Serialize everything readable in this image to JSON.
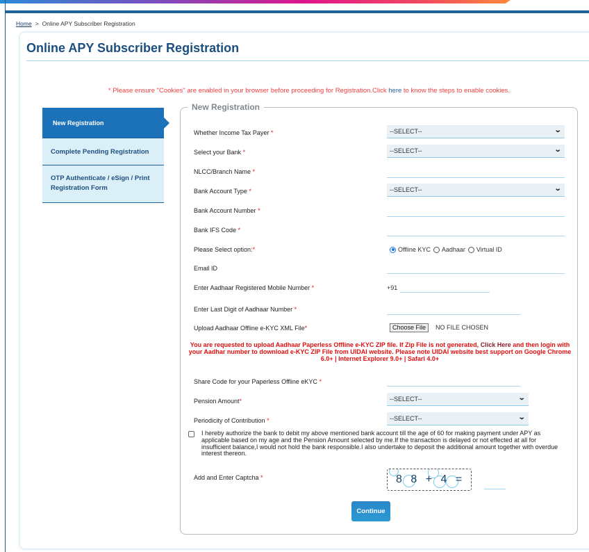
{
  "breadcrumb": {
    "home": "Home",
    "separator": ">",
    "current": "Online APY Subscriber Registration"
  },
  "page": {
    "title": "Online APY Subscriber Registration"
  },
  "cookie_notice": {
    "before": "* Please ensure \"Cookies\" are enabled in your browser before proceeding for Registration.Click ",
    "link": "here",
    "after": " to know the steps to enable cookies."
  },
  "side_nav": {
    "items": [
      {
        "label": "New Registration",
        "active": true
      },
      {
        "label": "Complete Pending Registration",
        "active": false
      },
      {
        "label": "OTP Authenticate / eSign / Print Registration Form",
        "active": false
      }
    ]
  },
  "form": {
    "legend": "New Registration",
    "required_mark": "*",
    "fields": {
      "income_tax": {
        "label": "Whether Income Tax Payer",
        "value": "--SELECT--"
      },
      "bank": {
        "label": "Select your Bank",
        "value": "--SELECT--"
      },
      "branch": {
        "label": "NLCC/Branch Name",
        "value": ""
      },
      "account_type": {
        "label": "Bank Account Type",
        "value": "--SELECT--"
      },
      "account_number": {
        "label": "Bank Account Number",
        "value": ""
      },
      "ifsc": {
        "label": "Bank IFS Code",
        "value": ""
      },
      "option": {
        "label": "Please Select option:",
        "options": [
          "Offline KYC",
          "Aadhaar",
          "Virtual ID"
        ],
        "selected": "Offline KYC"
      },
      "email": {
        "label": "Email ID",
        "value": ""
      },
      "mobile": {
        "label": "Enter Aadhaar Registered Mobile Number",
        "prefix": "+91",
        "value": ""
      },
      "aadhaar_last_digit": {
        "label": "Enter Last Digit of Aadhaar Number",
        "value": ""
      },
      "upload": {
        "label": "Upload Aadhaar Offline e-KYC XML File",
        "button": "Choose File",
        "status": "NO FILE CHOSEN"
      },
      "share_code": {
        "label": "Share Code for your Paperless Offline eKYC",
        "value": ""
      },
      "pension_amount": {
        "label": "Pension Amount",
        "value": "--SELECT--"
      },
      "periodicity": {
        "label": "Periodicity of Contribution",
        "value": "--SELECT--"
      },
      "captcha": {
        "label": "Add and Enter Captcha",
        "challenge": "8 8 + 4 =",
        "value": ""
      }
    },
    "upload_note": {
      "before": "You are requested to upload Aadhaar Paperless Offline e-KYC ZIP file. If Zip File is not generated, ",
      "link": "Click Here",
      "after": " and then login with your Aadhar number to download e-KYC ZIP File from UIDAI website. Please note UIDAI website best support on Google Chrome 6.0+ | Internet Explorer 9.0+ | Safari 4.0+"
    },
    "consent": {
      "checked": false,
      "text": "I hereby authorize the bank to debit my above mentioned bank account till the age of 60 for making payment under APY as applicable based on my age and the Pension Amount selected by me.If the transaction is delayed or not effected at all for insufficient balance,I would not hold the bank responsible.I also undertake to deposit the additional amount together with overdue interest thereon."
    },
    "continue_label": "Continue"
  },
  "icons": {
    "dropdown": "chevron-down-icon",
    "radio": "radio-icon",
    "checkbox": "checkbox-icon"
  },
  "colors": {
    "primary": "#1c72b8",
    "title": "#1b4f80",
    "warning": "#f04040",
    "accent_line": "#a9d8ee"
  }
}
